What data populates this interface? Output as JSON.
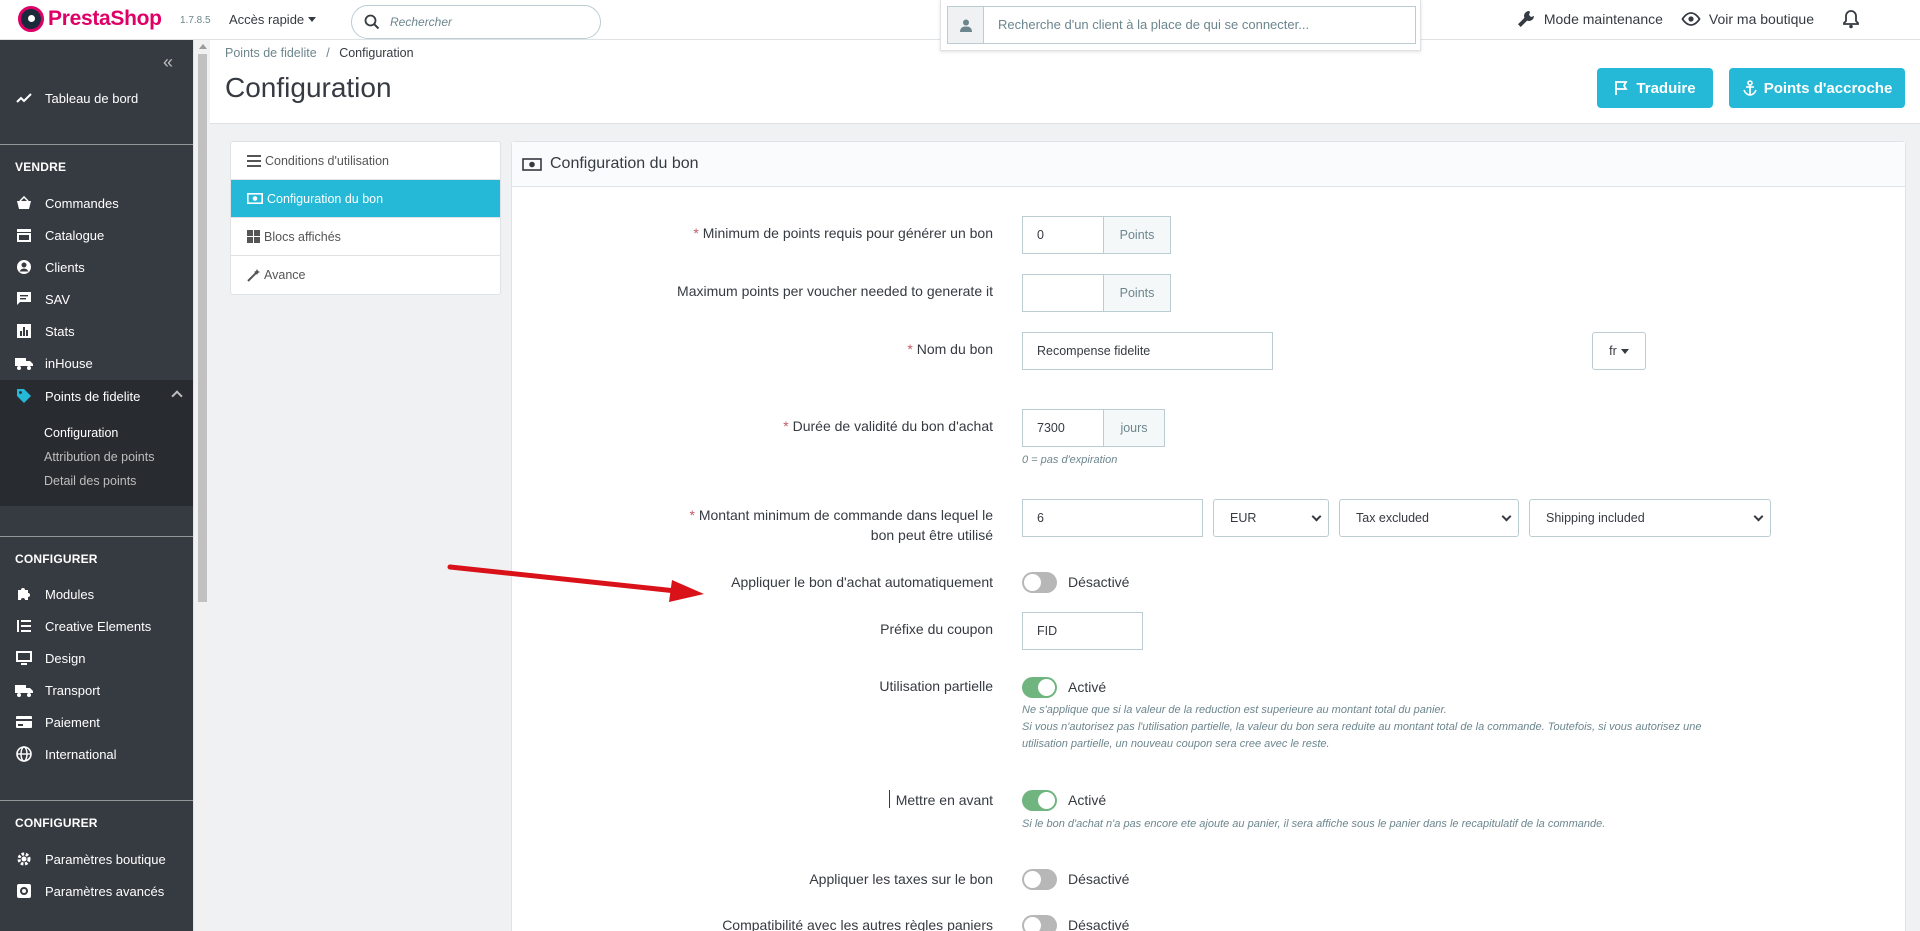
{
  "header": {
    "logo": "PrestaShop",
    "version": "1.7.8.5",
    "quick_access": "Accès rapide",
    "search_placeholder": "Rechercher",
    "customer_placeholder": "Recherche d'un client à la place de qui se connecter...",
    "maintenance": "Mode maintenance",
    "view_shop": "Voir ma boutique"
  },
  "sidebar": {
    "dashboard": "Tableau de bord",
    "section_sell": "VENDRE",
    "sell_items": [
      "Commandes",
      "Catalogue",
      "Clients",
      "SAV",
      "Stats",
      "inHouse",
      "Points de fidelite"
    ],
    "sub_items": [
      "Configuration",
      "Attribution de points",
      "Detail des points"
    ],
    "section_configure": "CONFIGURER",
    "configure_items": [
      "Modules",
      "Creative Elements",
      "Design",
      "Transport",
      "Paiement",
      "International"
    ],
    "section_configure2": "CONFIGURER",
    "configure2_items": [
      "Paramètres boutique",
      "Paramètres avancés"
    ]
  },
  "page": {
    "breadcrumb_parent": "Points de fidelite",
    "breadcrumb_sep": "/",
    "breadcrumb_current": "Configuration",
    "title": "Configuration",
    "translate_button": "Traduire",
    "hooks_button": "Points d'accroche"
  },
  "tabs": [
    "Conditions d'utilisation",
    "Configuration du bon",
    "Blocs affichés",
    "Avance"
  ],
  "panel": {
    "title": "Configuration du bon",
    "min_points_label": "Minimum de points requis pour générer un bon",
    "min_points_value": "0",
    "points_unit": "Points",
    "max_points_label": "Maximum points per voucher needed to generate it",
    "max_points_value": "",
    "voucher_name_label": "Nom du bon",
    "voucher_name_value": "Recompense fidelite",
    "lang": "fr",
    "validity_label": "Durée de validité du bon d'achat",
    "validity_value": "7300",
    "validity_unit": "jours",
    "validity_help": "0 = pas d'expiration",
    "min_amount_label_1": "Montant minimum de commande dans lequel le",
    "min_amount_label_2": "bon peut être utilisé",
    "min_amount_value": "6",
    "currency": "EUR",
    "tax": "Tax excluded",
    "shipping": "Shipping included",
    "auto_apply_label": "Appliquer le bon d'achat automatiquement",
    "auto_apply_state": "Désactivé",
    "prefix_label": "Préfixe du coupon",
    "prefix_value": "FID",
    "partial_label": "Utilisation partielle",
    "partial_state": "Activé",
    "partial_help_1": "Ne s'applique que si la valeur de la reduction est superieure au montant total du panier.",
    "partial_help_2": "Si vous n'autorisez pas l'utilisation partielle, la valeur du bon sera reduite au montant total de la commande. Toutefois, si vous autorisez une",
    "partial_help_3": "utilisation partielle, un nouveau coupon sera cree avec le reste.",
    "highlight_label": "Mettre en avant",
    "highlight_state": "Activé",
    "highlight_help": "Si le bon d'achat n'a pas encore ete ajoute au panier, il sera affiche sous le panier dans le recapitulatif de la commande.",
    "taxes_label": "Appliquer les taxes sur le bon",
    "taxes_state": "Désactivé",
    "compat_label": "Compatibilité avec les autres règles paniers",
    "compat_state": "Désactivé"
  },
  "colors": {
    "primary": "#25b9d7",
    "sidebar": "#363a41",
    "toggle_on": "#70b580",
    "annotation_arrow": "#d9121a"
  }
}
